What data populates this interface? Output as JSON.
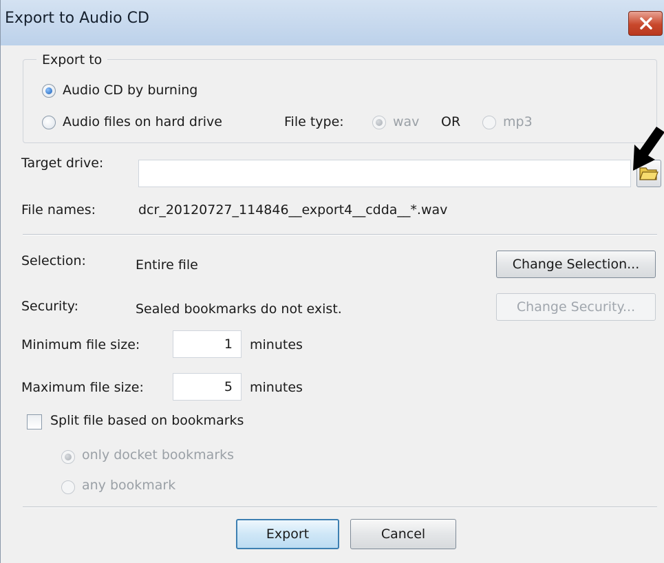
{
  "window": {
    "title": "Export to Audio CD"
  },
  "export_to": {
    "legend": "Export to",
    "option_cd": "Audio CD by burning",
    "option_files": "Audio files on hard drive",
    "file_type_label": "File type:",
    "wav_label": "wav",
    "or_label": "OR",
    "mp3_label": "mp3"
  },
  "target_drive": {
    "label": "Target drive:",
    "value": ""
  },
  "file_names": {
    "label": "File names:",
    "value": "dcr_20120727_114846__export4__cdda__*.wav"
  },
  "selection": {
    "label": "Selection:",
    "value": "Entire file",
    "button": "Change Selection..."
  },
  "security": {
    "label": "Security:",
    "value": "Sealed bookmarks do not exist.",
    "button": "Change Security..."
  },
  "min_size": {
    "label": "Minimum file size:",
    "value": "1",
    "unit": "minutes"
  },
  "max_size": {
    "label": "Maximum file size:",
    "value": "5",
    "unit": "minutes"
  },
  "split": {
    "label": "Split file based on bookmarks",
    "option_docket": "only docket bookmarks",
    "option_any": "any bookmark"
  },
  "buttons": {
    "export": "Export",
    "cancel": "Cancel"
  },
  "colors": {
    "title_bar": "#c8daef",
    "close_button": "#c9482c",
    "default_button_border": "#3c7fb1",
    "dialog_bg": "#f0f0f0"
  },
  "icons": {
    "close": "close-icon",
    "folder": "folder-icon",
    "pointer": "arrow-pointer-icon"
  }
}
